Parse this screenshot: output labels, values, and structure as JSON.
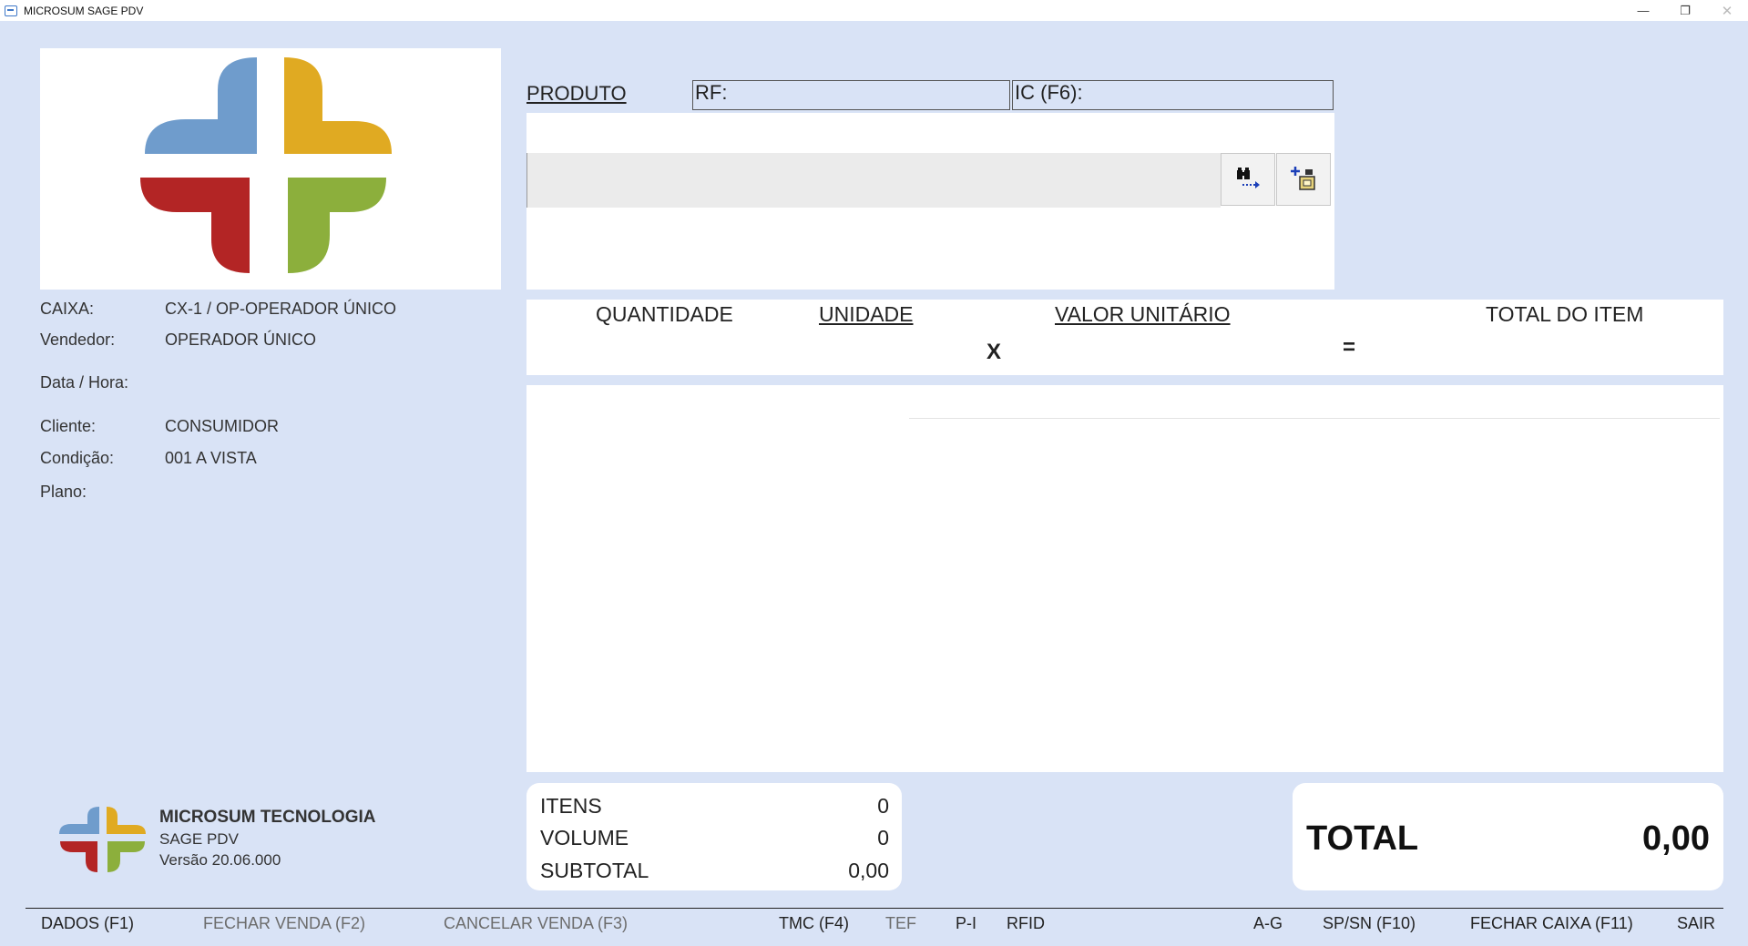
{
  "window": {
    "title": "MICROSUM SAGE PDV",
    "minimize": "—",
    "maximize": "❐",
    "close": "✕"
  },
  "info": {
    "caixa_label": "CAIXA:",
    "caixa_value": "CX-1 / OP-OPERADOR ÚNICO",
    "vendedor_label": "Vendedor:",
    "vendedor_value": "OPERADOR ÚNICO",
    "datahora_label": "Data / Hora:",
    "cliente_label": "Cliente:",
    "cliente_value": "CONSUMIDOR",
    "condicao_label": "Condição:",
    "condicao_value": "001 A VISTA",
    "plano_label": "Plano:"
  },
  "produto": {
    "label": "PRODUTO",
    "rf_label": "RF:",
    "ic_label": "IC (F6):",
    "input_value": ""
  },
  "item_columns": {
    "quantidade": "QUANTIDADE",
    "unidade": "UNIDADE",
    "valor_unitario": "VALOR UNITÁRIO",
    "total_item": "TOTAL DO ITEM",
    "times": "X",
    "equals": "="
  },
  "company": {
    "name": "MICROSUM TECNOLOGIA",
    "product": "SAGE PDV",
    "version": "Versão 20.06.000"
  },
  "summary": {
    "itens_label": "ITENS",
    "itens_value": "0",
    "volume_label": "VOLUME",
    "volume_value": "0",
    "subtotal_label": "SUBTOTAL",
    "subtotal_value": "0,00"
  },
  "total": {
    "label": "TOTAL",
    "value": "0,00"
  },
  "fkeys": {
    "dados": "DADOS (F1)",
    "fechar_venda": "FECHAR VENDA (F2)",
    "cancelar_venda": "CANCELAR VENDA (F3)",
    "tmc": "TMC (F4)",
    "tef": "TEF",
    "pi": "P-I",
    "rfid": "RFID",
    "ag": "A-G",
    "spsn": "SP/SN (F10)",
    "fechar_caixa": "FECHAR CAIXA (F11)",
    "sair": "SAIR"
  },
  "colors": {
    "background": "#d9e3f6",
    "logo_blue": "#6f9ccc",
    "logo_yellow": "#e0aa22",
    "logo_red": "#b32525",
    "logo_green": "#8caf3c"
  }
}
